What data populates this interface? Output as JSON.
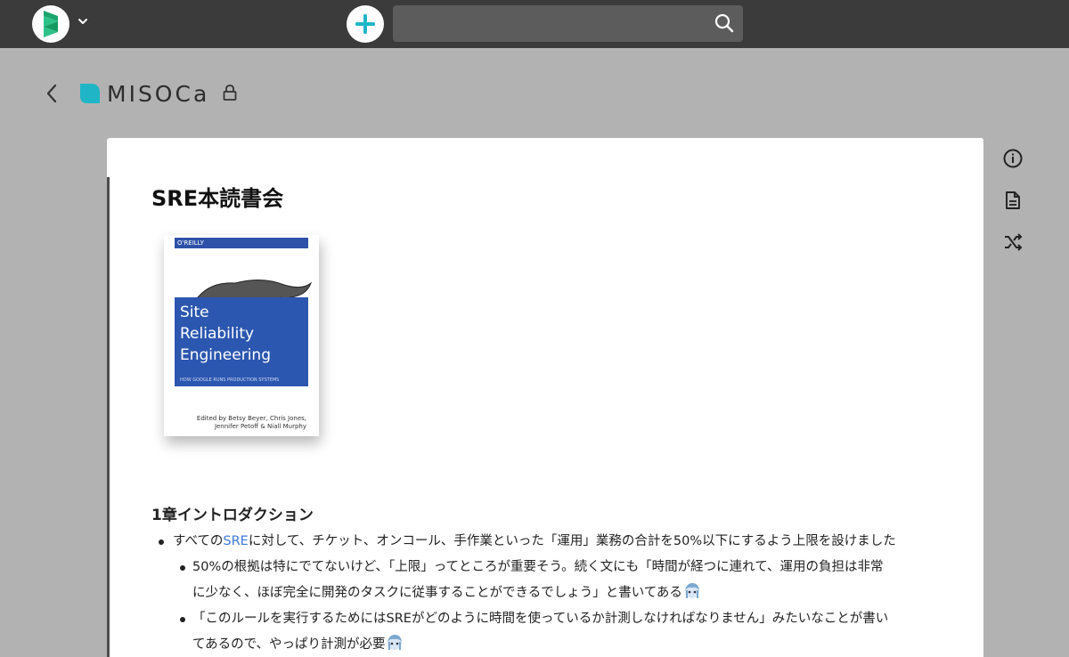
{
  "search": {
    "placeholder": "",
    "value": ""
  },
  "header": {
    "brand": "MISOCa"
  },
  "document": {
    "title": "SRE本読書会",
    "book": {
      "publisher": "O'REILLY",
      "title_lines": [
        "Site",
        "Reliability",
        "Engineering"
      ],
      "subtitle": "HOW GOOGLE RUNS PRODUCTION SYSTEMS",
      "editors_line1": "Edited by Betsy Beyer, Chris Jones,",
      "editors_line2": "Jennifer Petoff & Niall Murphy"
    },
    "section_heading": "1章イントロダクション",
    "bullet1_pre": "すべての",
    "bullet1_link": "SRE",
    "bullet1_post": "に対して、チケット、オンコール、手作業といった「運用」業務の合計を50%以下にするよう上限を設けました",
    "sub1_line1": "50%の根拠は特にでてないけど、「上限」ってところが重要そう。続く文にも「時間が経つに連れて、運用の負担は非常",
    "sub1_line2": "に少なく、ほぼ完全に開発のタスクに従事することができるでしょう」と書いてある",
    "sub2_line1": "「このルールを実行するためにはSREがどのように時間を使っているか計測しなければなりません」みたいなことが書い",
    "sub2_line2": "てあるので、やっぱり計測が必要"
  },
  "icons": {
    "app_logo": "app-logo-icon",
    "add": "plus-icon",
    "search": "search-icon",
    "back": "chevron-left-icon",
    "lock": "lock-icon",
    "info": "info-icon",
    "document": "document-icon",
    "shuffle": "shuffle-icon"
  },
  "colors": {
    "topbar": "#3b3b3b",
    "accent": "#1fb5c7",
    "link": "#3c78d8",
    "book_blue": "#2c57b0"
  }
}
